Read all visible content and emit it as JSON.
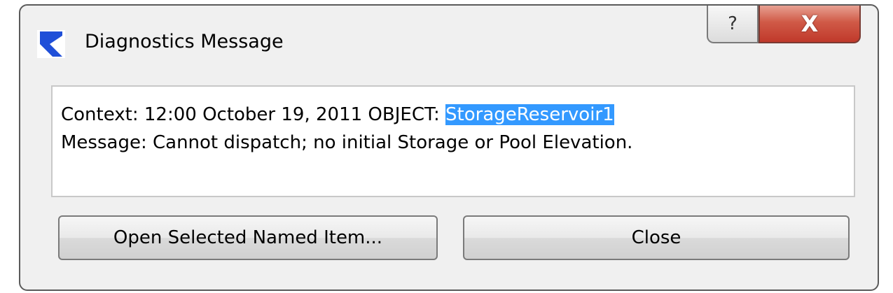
{
  "window": {
    "title": "Diagnostics Message",
    "help_label": "?",
    "close_label": "X"
  },
  "message": {
    "context_prefix": "Context: 12:00 October 19, 2011 OBJECT: ",
    "context_object": "StorageReservoir1",
    "message_text": "Message: Cannot dispatch; no initial Storage or Pool Elevation."
  },
  "buttons": {
    "open_selected": "Open Selected Named Item...",
    "close": "Close"
  },
  "colors": {
    "selection_highlight": "#3399ff",
    "close_button": "#c0392b",
    "app_icon": "#1f4fd8"
  },
  "icons": {
    "app": "riverware-logo-icon",
    "help": "help-question-icon",
    "close": "close-x-icon"
  }
}
